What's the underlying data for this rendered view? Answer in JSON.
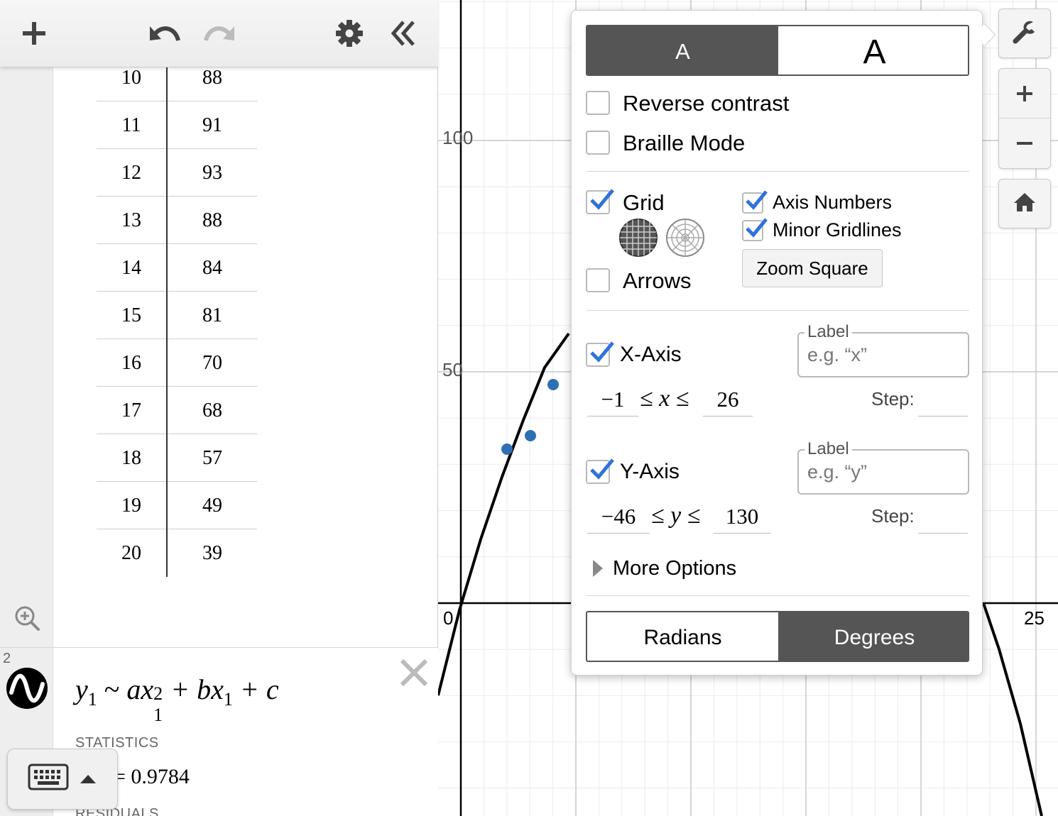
{
  "graph": {
    "axis_labels": {
      "y100": "100",
      "y50": "50",
      "x0": "0",
      "x25": "25"
    }
  },
  "table": {
    "rows": [
      {
        "x": "10",
        "y": "88"
      },
      {
        "x": "11",
        "y": "91"
      },
      {
        "x": "12",
        "y": "93"
      },
      {
        "x": "13",
        "y": "88"
      },
      {
        "x": "14",
        "y": "84"
      },
      {
        "x": "15",
        "y": "81"
      },
      {
        "x": "16",
        "y": "70"
      },
      {
        "x": "17",
        "y": "68"
      },
      {
        "x": "18",
        "y": "57"
      },
      {
        "x": "19",
        "y": "49"
      },
      {
        "x": "20",
        "y": "39"
      }
    ]
  },
  "expression2": {
    "number": "2",
    "lhs": "y",
    "lhs_sub": "1",
    "tilde": " ~ ",
    "a": "ax",
    "a_sup": "2",
    "a_sub": "1",
    "plus_b": " + bx",
    "b_sub": "1",
    "plus_c": " + c",
    "statistics_label": "STATISTICS",
    "statistic_value": "= 0.9784",
    "residuals_label": "RESIDUALS"
  },
  "settings": {
    "font_small": "A",
    "font_large": "A",
    "reverse_contrast": "Reverse contrast",
    "braille_mode": "Braille Mode",
    "grid": "Grid",
    "axis_numbers": "Axis Numbers",
    "minor_gridlines": "Minor Gridlines",
    "zoom_square": "Zoom Square",
    "arrows": "Arrows",
    "x_axis": "X-Axis",
    "y_axis": "Y-Axis",
    "label_legend": "Label",
    "x_label_placeholder": "e.g. “x”",
    "y_label_placeholder": "e.g. “y”",
    "x_min": "−1",
    "x_max": "26",
    "x_ineq": "≤ x ≤",
    "y_min": "−46",
    "y_max": "130",
    "y_ineq": "≤ y ≤",
    "step": "Step:",
    "more_options": "More Options",
    "radians": "Radians",
    "degrees": "Degrees",
    "checked": {
      "reverse_contrast": false,
      "braille_mode": false,
      "grid": true,
      "axis_numbers": true,
      "minor_gridlines": true,
      "arrows": false,
      "x_axis": true,
      "y_axis": true
    }
  },
  "colors": {
    "accent": "#2f72dc",
    "point": "#2d70b3",
    "active_segment": "#555555"
  },
  "icons": [
    "add-icon",
    "undo-icon",
    "redo-icon",
    "gear-icon",
    "collapse-icon",
    "zoom-fit-icon",
    "regression-icon",
    "close-icon",
    "keyboard-icon",
    "wrench-icon",
    "zoom-in-icon",
    "zoom-out-icon",
    "home-icon"
  ]
}
